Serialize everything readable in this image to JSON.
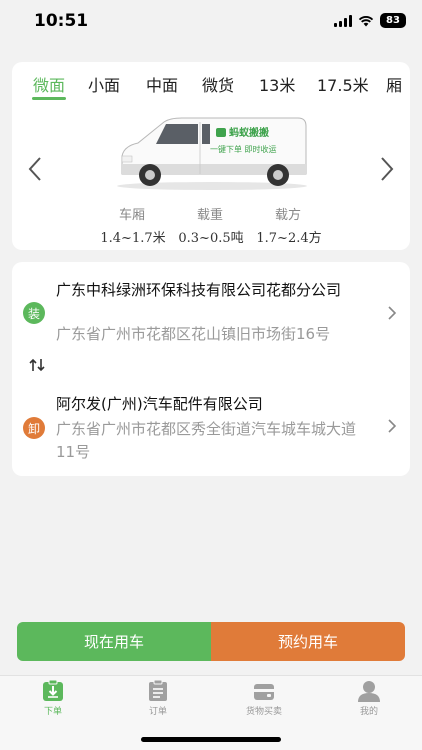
{
  "status_bar": {
    "time": "10:51",
    "battery": "83"
  },
  "vehicle_tabs": [
    "微面",
    "小面",
    "中面",
    "微货",
    "13米",
    "17.5米",
    "厢"
  ],
  "active_tab": 0,
  "van_branding": {
    "brand": "蚂蚁搬搬",
    "slogan": "一键下单 即时收运"
  },
  "specs": [
    {
      "label": "车厢",
      "value": "1.4~1.7米"
    },
    {
      "label": "载重",
      "value": "0.3~0.5吨"
    },
    {
      "label": "载方",
      "value": "1.7~2.4方"
    }
  ],
  "route": {
    "load": {
      "badge": "装",
      "company": "广东中科绿洲环保科技有限公司花都分公司",
      "address": "广东省广州市花都区花山镇旧市场街16号"
    },
    "unload": {
      "badge": "卸",
      "company": "阿尔发(广州)汽车配件有限公司",
      "address": "广东省广州市花都区秀全街道汽车城车城大道11号"
    }
  },
  "buttons": {
    "now": "现在用车",
    "book": "预约用车"
  },
  "tabbar": [
    {
      "label": "下单",
      "icon": "order-download-icon"
    },
    {
      "label": "订单",
      "icon": "clipboard-icon"
    },
    {
      "label": "货物买卖",
      "icon": "wallet-icon"
    },
    {
      "label": "我的",
      "icon": "person-icon"
    }
  ],
  "colors": {
    "accent_green": "#5cb85c",
    "accent_orange": "#e07b39"
  }
}
